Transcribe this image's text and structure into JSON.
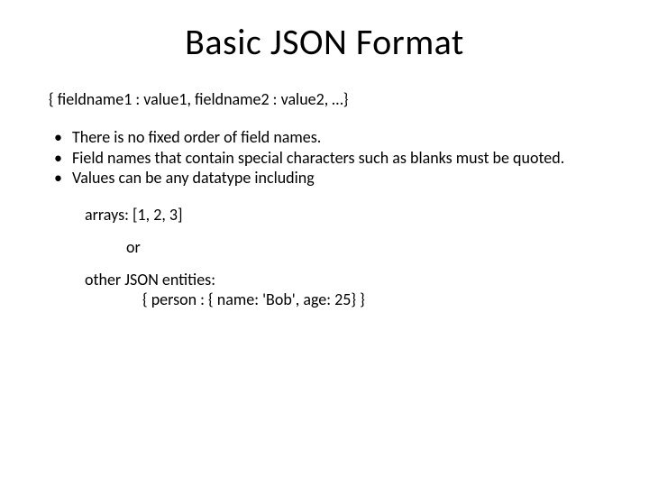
{
  "title": "Basic JSON Format",
  "syntax": "{ fieldname1 :  value1, fieldname2 : value2, …}",
  "bullets": [
    "There is no fixed order of field names.",
    "Field names that contain special characters such as blanks must be quoted.",
    "Values can be any datatype including"
  ],
  "example_arrays": "arrays:  [1, 2, 3]",
  "or_text": "or",
  "example_entities_label": "other JSON entities:",
  "example_entities_value": "{ person :  { name: 'Bob', age: 25}  }"
}
